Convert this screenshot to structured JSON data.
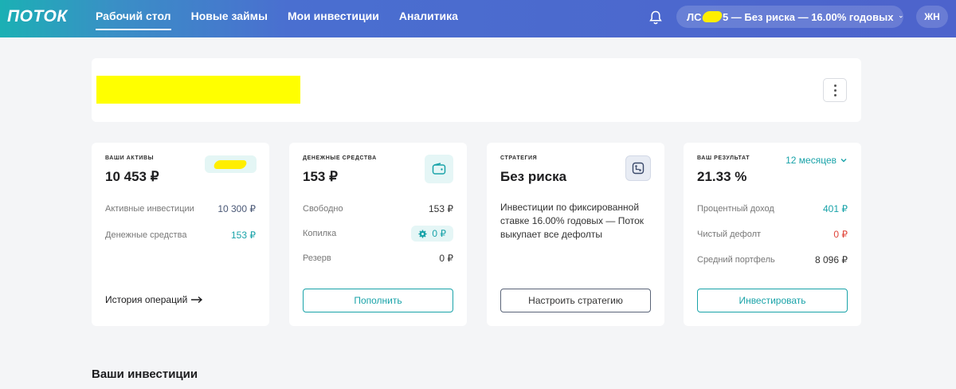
{
  "header": {
    "logo": "ПОТОК",
    "nav": [
      {
        "label": "Рабочий стол",
        "active": true
      },
      {
        "label": "Новые займы",
        "active": false
      },
      {
        "label": "Мои инвестиции",
        "active": false
      },
      {
        "label": "Аналитика",
        "active": false
      }
    ],
    "account": {
      "prefix": "ЛС",
      "suffix": "5 — Без риска — 16.00% годовых"
    },
    "avatar": "ЖН"
  },
  "cards": {
    "assets": {
      "overline": "ваши активы",
      "value": "10 453 ₽",
      "rows": [
        {
          "label": "Активные инвестиции",
          "value": "10 300 ₽"
        },
        {
          "label": "Денежные средства",
          "value": "153 ₽"
        }
      ],
      "link": "История операций"
    },
    "cash": {
      "overline": "денежные средства",
      "value": "153 ₽",
      "rows": [
        {
          "label": "Свободно",
          "value": "153 ₽"
        },
        {
          "label": "Копилка",
          "value": "0 ₽"
        },
        {
          "label": "Резерв",
          "value": "0 ₽"
        }
      ],
      "button": "Пополнить"
    },
    "strategy": {
      "overline": "стратегия",
      "value": "Без риска",
      "description": "Инвестиции по фиксированной ставке 16.00% годовых — Поток выкупает все дефолты",
      "button": "Настроить стратегию"
    },
    "result": {
      "overline": "ваш результат",
      "value": "21.33 %",
      "period": "12 месяцев",
      "rows": [
        {
          "label": "Процентный доход",
          "value": "401 ₽"
        },
        {
          "label": "Чистый дефолт",
          "value": "0 ₽"
        },
        {
          "label": "Средний портфель",
          "value": "8 096 ₽"
        }
      ],
      "button": "Инвестировать"
    }
  },
  "section": {
    "title": "Ваши инвестиции"
  },
  "colors": {
    "accent": "#19a3a9",
    "negative": "#e0453a",
    "header_from": "#1bb0b4",
    "header_to": "#4d63cc",
    "redaction": "#ffff00"
  }
}
